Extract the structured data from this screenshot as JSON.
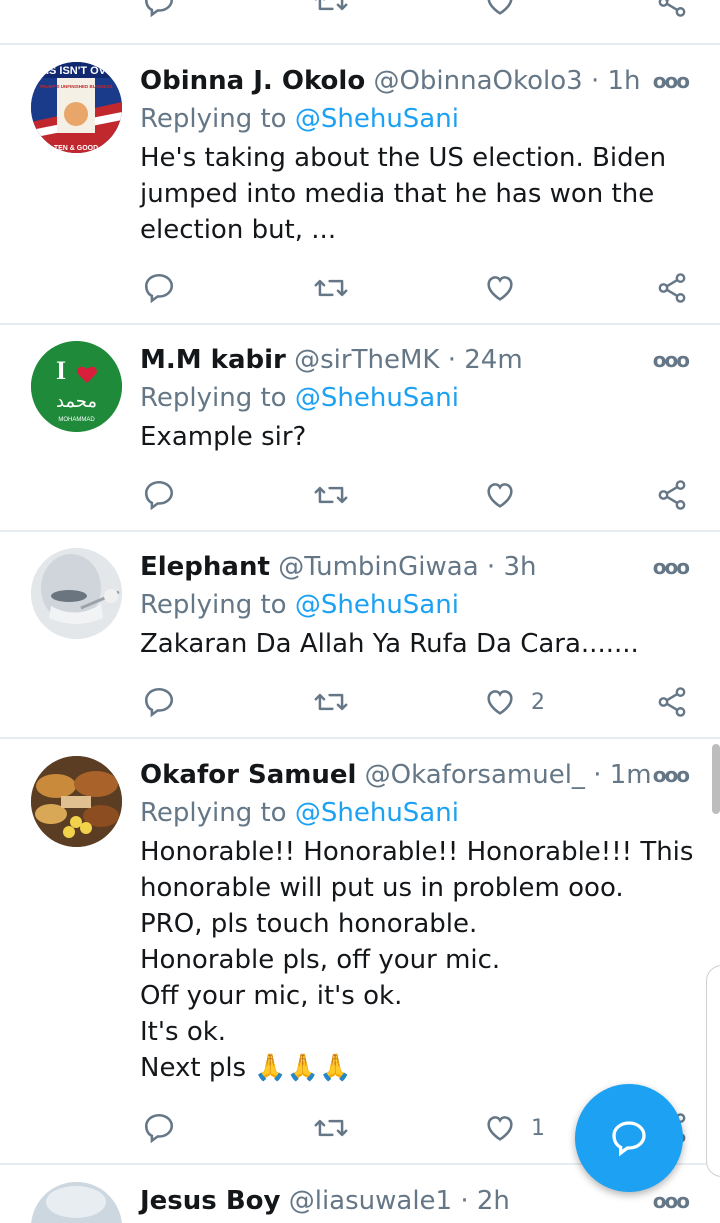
{
  "top_actions": {
    "reply": "",
    "retweet": "",
    "like": "",
    "share": ""
  },
  "tweets": [
    {
      "name": "Obinna J. Okolo",
      "handle": "@ObinnaOkolo3",
      "time": "1h",
      "reply_prefix": "Replying to",
      "reply_to": "@ShehuSani",
      "text": [
        "He's taking about the US election. Biden",
        "jumped into media that he has won the",
        "election but, ..."
      ],
      "likes": ""
    },
    {
      "name": "M.M kabir",
      "handle": "@sirTheMK",
      "time": "24m",
      "reply_prefix": "Replying to",
      "reply_to": "@ShehuSani",
      "text": [
        "Example sir?"
      ],
      "likes": ""
    },
    {
      "name": "Elephant",
      "handle": "@TumbinGiwaa",
      "time": "3h",
      "reply_prefix": "Replying to",
      "reply_to": "@ShehuSani",
      "text": [
        "Zakaran Da Allah Ya Rufa Da Cara......."
      ],
      "likes": "2"
    },
    {
      "name": "Okafor Samuel",
      "handle": "@Okaforsamuel_",
      "time": "1m",
      "reply_prefix": "Replying to",
      "reply_to": "@ShehuSani",
      "text": [
        "Honorable!! Honorable!! Honorable!!! This",
        "honorable will put us in problem ooo.",
        "PRO, pls touch honorable.",
        "Honorable pls, off your mic.",
        "Off your mic, it's ok.",
        "It's ok.",
        "Next pls 🙏🙏🙏"
      ],
      "likes": "1"
    },
    {
      "name": "Jesus Boy",
      "handle": "@liasuwale1",
      "time": "2h"
    }
  ],
  "separator": "·",
  "more_glyph": "ooo",
  "avatar_text": {
    "a1_banner": "IS ISN'T OV",
    "a1_cover": "TRUMP'S UNFINISHED BUSINESS",
    "a1_footer": "TEN & GOOD",
    "a2_letter": "I",
    "a2_arabic": "محمد",
    "a2_caption": "MOHAMMAD"
  },
  "colors": {
    "accent": "#1da1f2",
    "text": "#14171a",
    "muted": "#657786",
    "divider": "#e6ecf0",
    "heart": "#e0245e",
    "avatar_green": "#1e8a3a"
  },
  "icons": [
    "reply-icon",
    "retweet-icon",
    "heart-icon",
    "share-icon",
    "more-icon",
    "compose-reply-icon"
  ]
}
